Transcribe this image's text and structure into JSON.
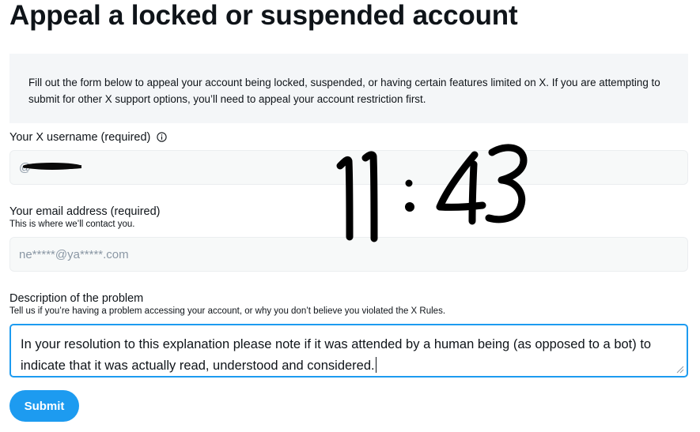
{
  "page": {
    "title": "Appeal a locked or suspended account",
    "notice": "Fill out the form below to appeal your account being locked, suspended, or having certain features limited on X. If you are attempting to submit for other X support options, you’ll need to appeal your account restriction first."
  },
  "form": {
    "username": {
      "label": "Your X username (required)",
      "value": "@"
    },
    "email": {
      "label": "Your email address (required)",
      "help": "This is where we’ll contact you.",
      "value": "ne*****@ya*****.com"
    },
    "description": {
      "label": "Description of the problem",
      "help": "Tell us if you’re having a problem accessing your account, or why you don’t believe you violated the X Rules.",
      "value": "In your resolution to this explanation please note if it was attended by a human being (as opposed to a bot) to indicate that it was actually read, understood and considered."
    },
    "submit_label": "Submit"
  },
  "annotation": {
    "handwritten_time": "11:43"
  },
  "colors": {
    "accent": "#1d9bf0",
    "notice_bg": "#f4f6f8",
    "field_bg": "#f7f9f9"
  }
}
